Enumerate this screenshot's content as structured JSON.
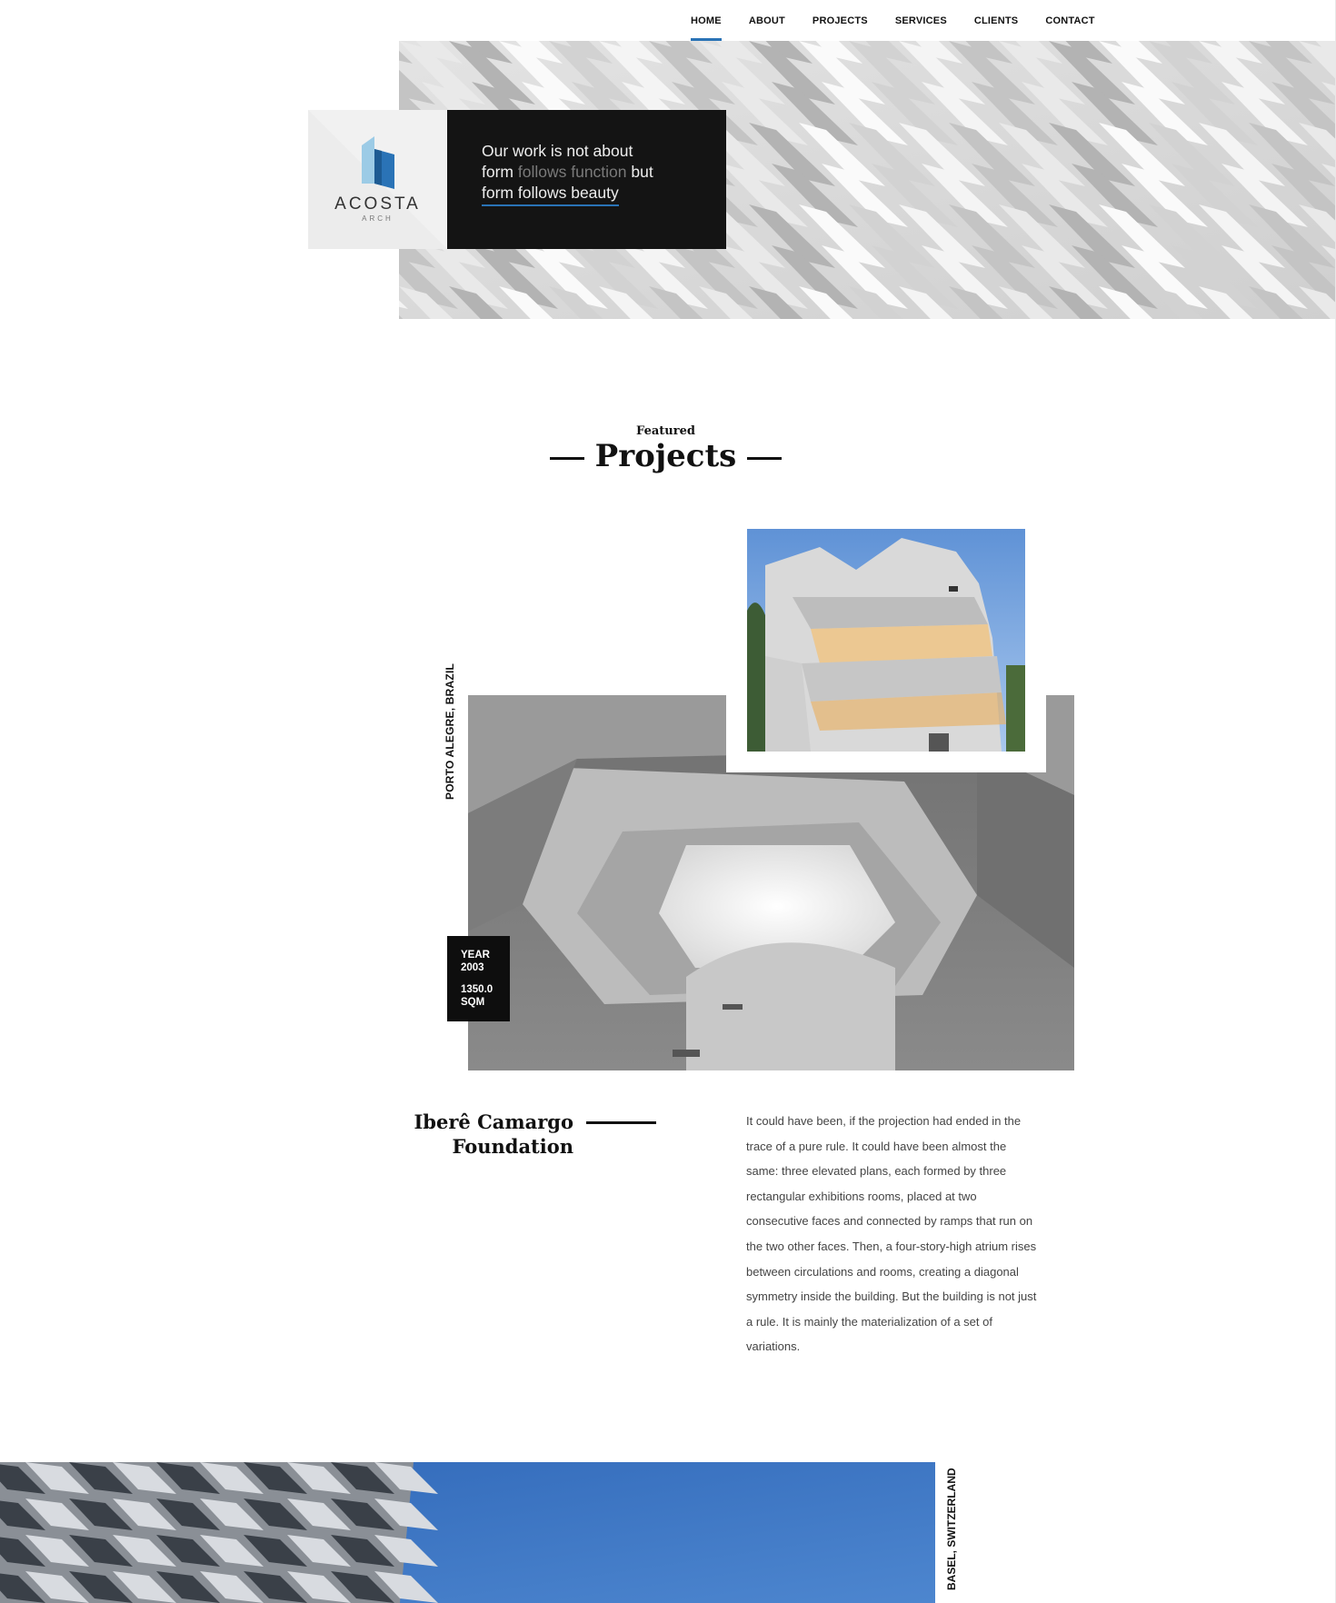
{
  "nav": {
    "items": [
      {
        "label": "HOME",
        "active": true
      },
      {
        "label": "ABOUT"
      },
      {
        "label": "PROJECTS"
      },
      {
        "label": "SERVICES"
      },
      {
        "label": "CLIENTS"
      },
      {
        "label": "CONTACT"
      }
    ],
    "accent_color": "#2a73b6"
  },
  "brand": {
    "name": "ACOSTA",
    "sub": "ARCH",
    "logo_icon": "building-logo-icon"
  },
  "hero": {
    "tagline_part1": "Our work is not about",
    "tagline_part2": "form",
    "tagline_part3": "follows function",
    "tagline_part4": "but",
    "tagline_part5": "form follows beauty"
  },
  "featured": {
    "small": "Featured",
    "title": "Projects"
  },
  "project": {
    "location": "PORTO ALEGRE, BRAZIL",
    "year_label": "YEAR",
    "year": "2003",
    "area_value": "1350.0",
    "area_unit": "SQM",
    "title_line1": "Iberê Camargo",
    "title_line2": "Foundation",
    "description": "It could have been, if the projection had ended in the trace of a pure rule. It could have been almost the same: three elevated plans, each formed by three rectangular exhibitions rooms, placed at two consecutive faces and connected by ramps that run on the two other faces. Then, a four-story-high atrium rises between circulations and rooms, creating a diagonal symmetry inside the building. But the building is not just a rule. It is mainly the materialization of a set of variations."
  },
  "next_project": {
    "location": "BASEL, SWITZERLAND"
  }
}
